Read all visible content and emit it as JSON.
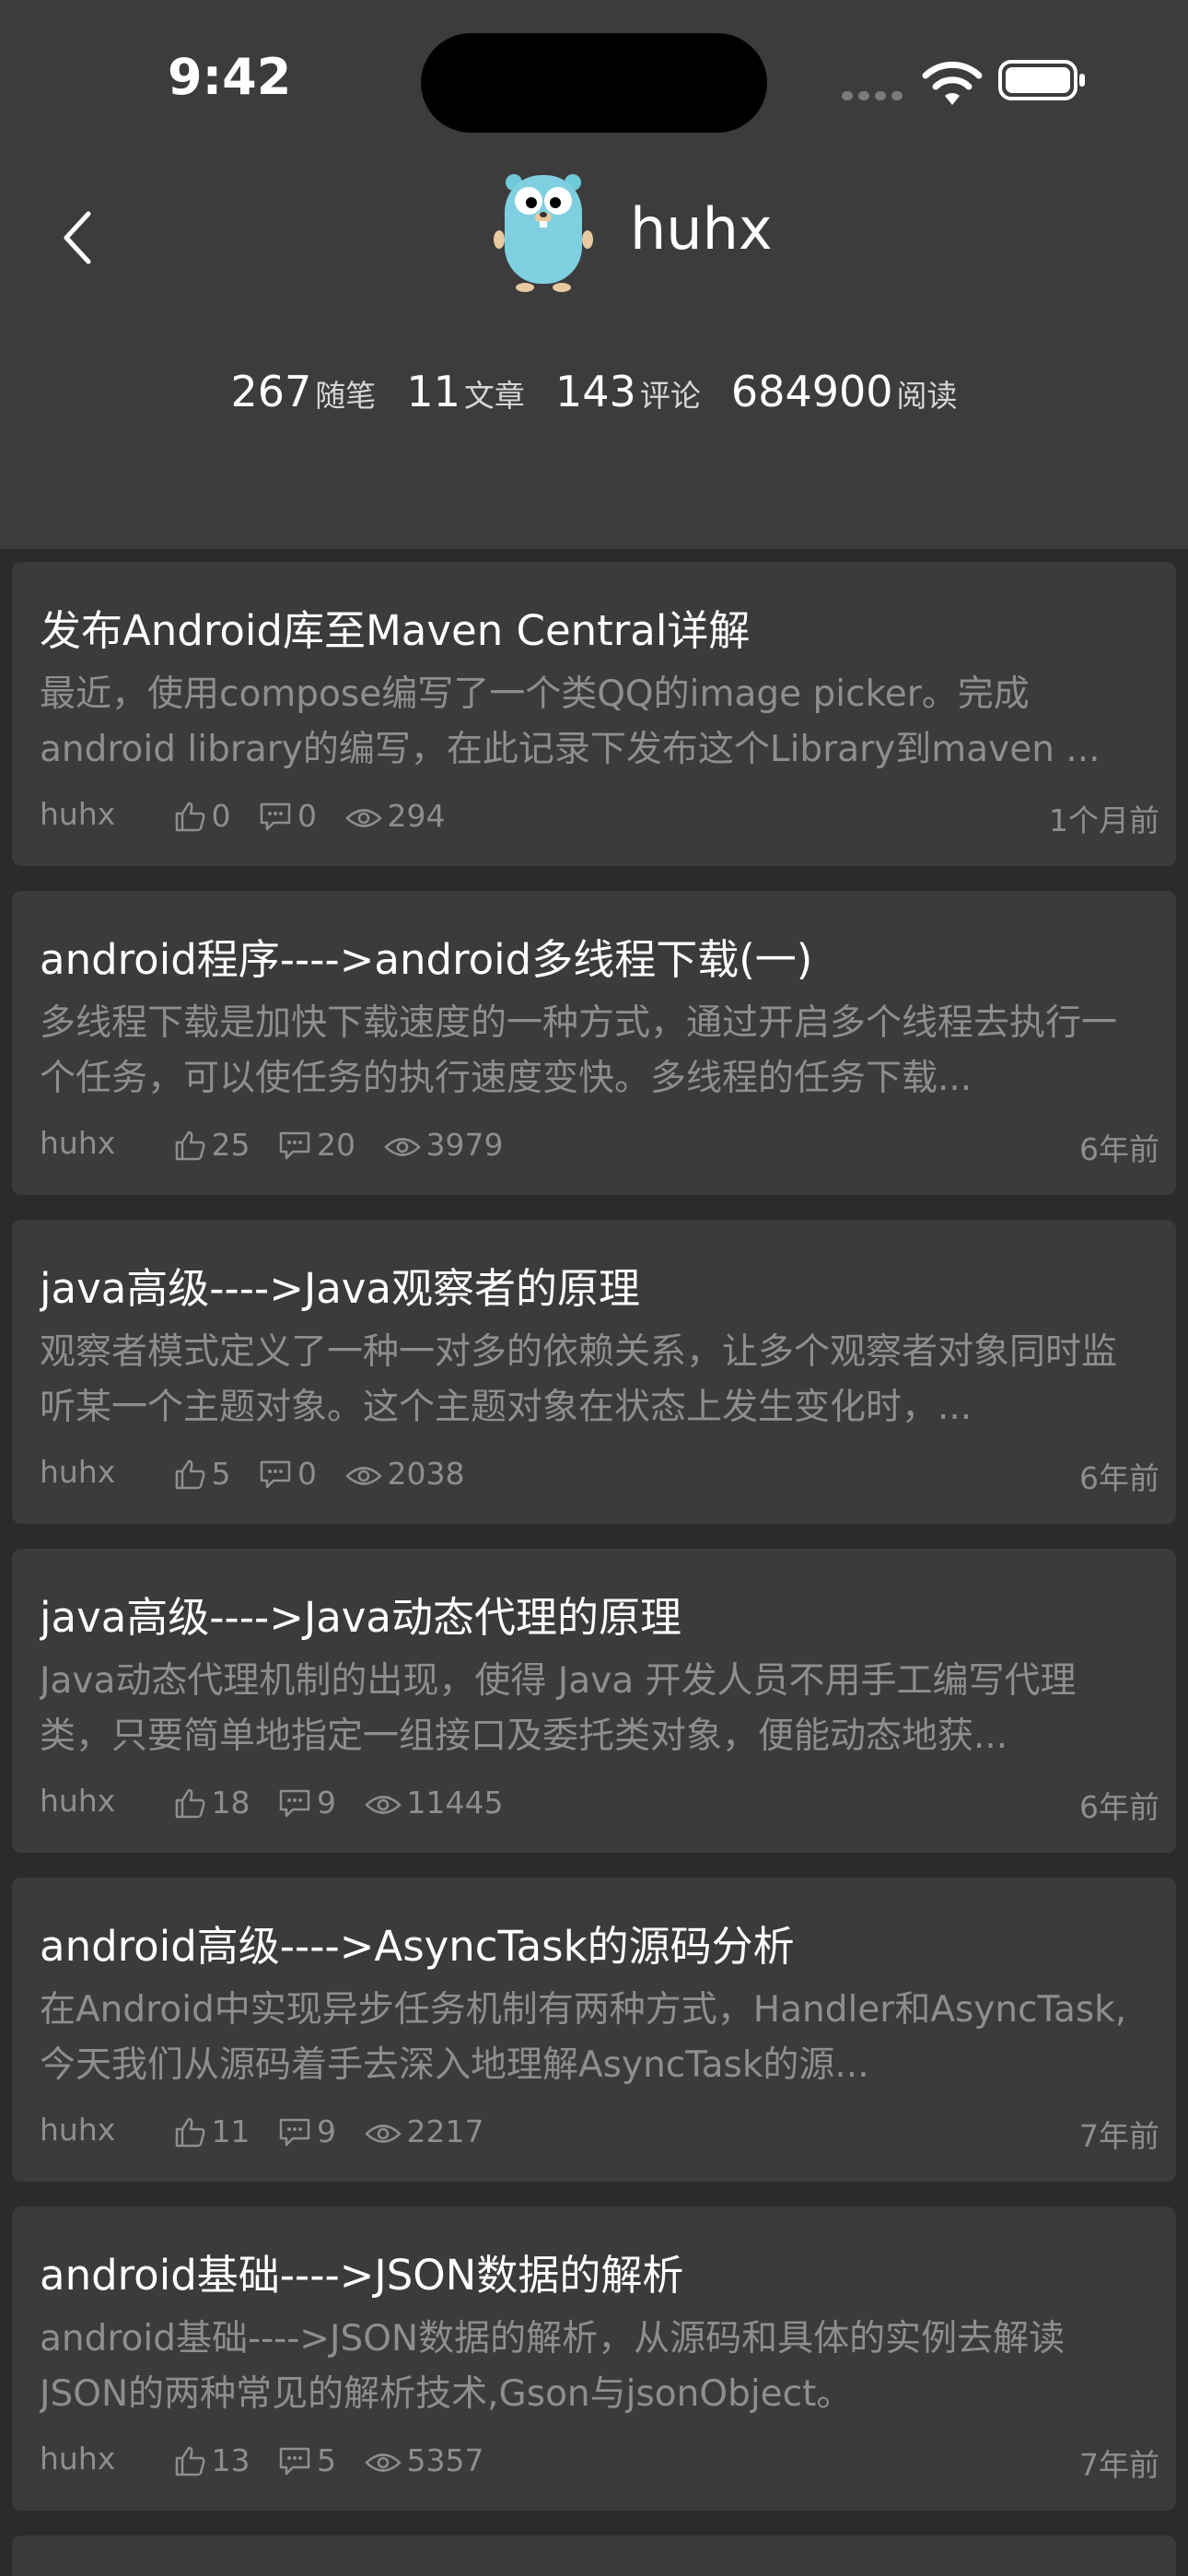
{
  "status_bar": {
    "time": "9:42"
  },
  "profile": {
    "name": "huhx",
    "stats": [
      {
        "value": "267",
        "label": "随笔"
      },
      {
        "value": "11",
        "label": "文章"
      },
      {
        "value": "143",
        "label": "评论"
      },
      {
        "value": "684900",
        "label": "阅读"
      }
    ]
  },
  "posts": [
    {
      "title": "发布Android库至Maven Central详解",
      "summary": "最近，使用compose编写了一个类QQ的image picker。完成android library的编写，在此记录下发布这个Library到maven ...",
      "author": "huhx",
      "likes": "0",
      "comments": "0",
      "views": "294",
      "time": "1个月前"
    },
    {
      "title": "android程序---->android多线程下载(一)",
      "summary": "多线程下载是加快下载速度的一种方式，通过开启多个线程去执行一个任务，可以使任务的执行速度变快。多线程的任务下载...",
      "author": "huhx",
      "likes": "25",
      "comments": "20",
      "views": "3979",
      "time": "6年前"
    },
    {
      "title": "java高级---->Java观察者的原理",
      "summary": "观察者模式定义了一种一对多的依赖关系，让多个观察者对象同时监听某一个主题对象。这个主题对象在状态上发生变化时，...",
      "author": "huhx",
      "likes": "5",
      "comments": "0",
      "views": "2038",
      "time": "6年前"
    },
    {
      "title": "java高级---->Java动态代理的原理",
      "summary": "Java动态代理机制的出现，使得 Java 开发人员不用手工编写代理类，只要简单地指定一组接口及委托类对象，便能动态地获...",
      "author": "huhx",
      "likes": "18",
      "comments": "9",
      "views": "11445",
      "time": "6年前"
    },
    {
      "title": "android高级---->AsyncTask的源码分析",
      "summary": "在Android中实现异步任务机制有两种方式，Handler和AsyncTask,今天我们从源码着手去深入地理解AsyncTask的源...",
      "author": "huhx",
      "likes": "11",
      "comments": "9",
      "views": "2217",
      "time": "7年前"
    },
    {
      "title": "android基础---->JSON数据的解析",
      "summary": "android基础---->JSON数据的解析，从源码和具体的实例去解读JSON的两种常见的解析技术,Gson与jsonObject。",
      "author": "huhx",
      "likes": "13",
      "comments": "5",
      "views": "5357",
      "time": "7年前"
    }
  ]
}
